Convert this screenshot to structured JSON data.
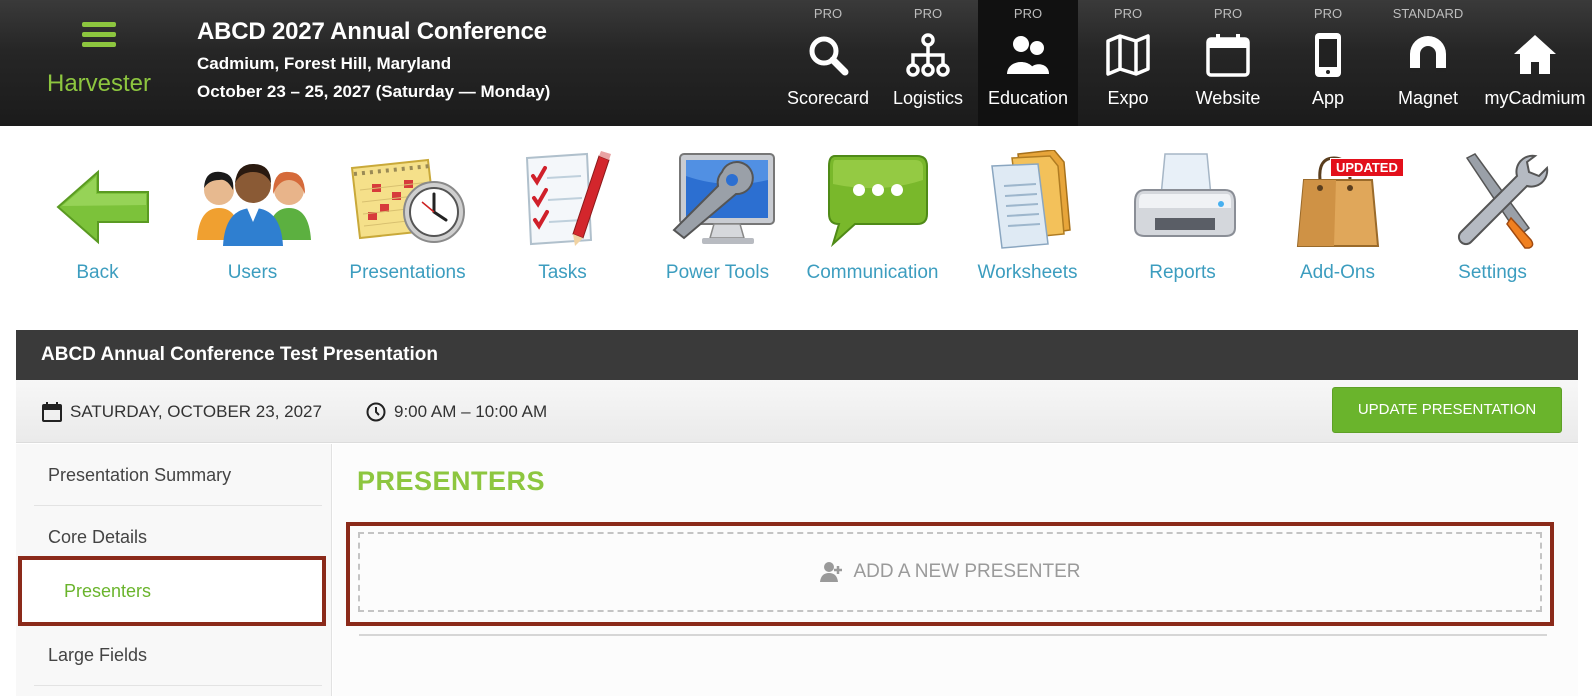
{
  "header": {
    "app_name": "Harvester",
    "event_title": "ABCD 2027 Annual Conference",
    "event_location": "Cadmium, Forest Hill, Maryland",
    "event_dates": "October 23 – 25, 2027 (Saturday — Monday)",
    "modules": [
      {
        "tier": "PRO",
        "label": "Scorecard",
        "icon": "search-icon"
      },
      {
        "tier": "PRO",
        "label": "Logistics",
        "icon": "org-chart-icon"
      },
      {
        "tier": "PRO",
        "label": "Education",
        "icon": "people-icon",
        "active": true
      },
      {
        "tier": "PRO",
        "label": "Expo",
        "icon": "map-icon"
      },
      {
        "tier": "PRO",
        "label": "Website",
        "icon": "calendar-icon"
      },
      {
        "tier": "PRO",
        "label": "App",
        "icon": "phone-icon"
      },
      {
        "tier": "STANDARD",
        "label": "Magnet",
        "icon": "magnet-icon"
      },
      {
        "tier": "",
        "label": "myCadmium",
        "icon": "home-icon"
      }
    ]
  },
  "tools": [
    {
      "label": "Back",
      "icon": "back-arrow-icon"
    },
    {
      "label": "Users",
      "icon": "users-icon"
    },
    {
      "label": "Presentations",
      "icon": "calendar-clock-icon"
    },
    {
      "label": "Tasks",
      "icon": "checklist-icon"
    },
    {
      "label": "Power Tools",
      "icon": "wrench-monitor-icon"
    },
    {
      "label": "Communication",
      "icon": "chat-bubble-icon"
    },
    {
      "label": "Worksheets",
      "icon": "folders-icon"
    },
    {
      "label": "Reports",
      "icon": "printer-icon"
    },
    {
      "label": "Add-Ons",
      "icon": "shopping-bag-icon",
      "badge": "UPDATED"
    },
    {
      "label": "Settings",
      "icon": "tools-icon"
    }
  ],
  "presentation": {
    "title": "ABCD Annual Conference Test Presentation",
    "date": "SATURDAY, OCTOBER 23, 2027",
    "time": "9:00 AM – 10:00 AM",
    "update_button": "UPDATE PRESENTATION"
  },
  "sidebar": {
    "items": [
      {
        "label": "Presentation Summary"
      },
      {
        "label": "Core Details"
      },
      {
        "label": "Presenters",
        "active": true
      },
      {
        "label": "Large Fields"
      }
    ]
  },
  "content": {
    "title": "PRESENTERS",
    "add_label": "ADD A NEW PRESENTER"
  },
  "colors": {
    "brand_green": "#8dc63f",
    "button_green": "#6ab42c",
    "link_blue": "#3c9dbf",
    "highlight_red": "#8b2a1a",
    "badge_red": "#e3101b"
  }
}
